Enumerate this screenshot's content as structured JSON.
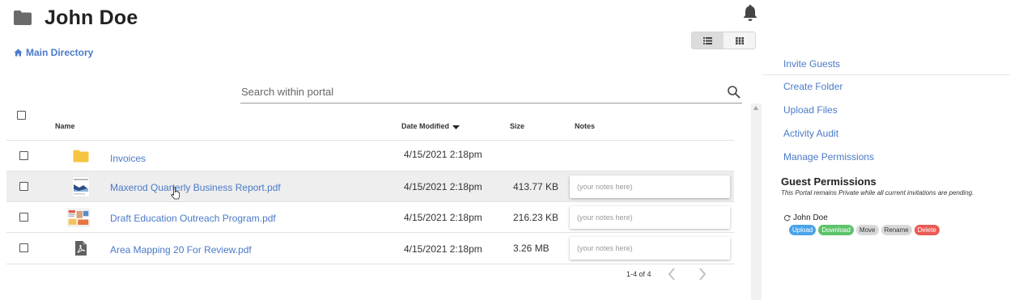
{
  "header": {
    "title": "John Doe",
    "icon": "folder-icon"
  },
  "breadcrumb": {
    "label": "Main Directory",
    "icon": "home-icon"
  },
  "view_toggle": {
    "options": [
      "list-view-icon",
      "grid-view-icon"
    ],
    "selected": "list-view-icon"
  },
  "search": {
    "placeholder": "Search within portal",
    "value": ""
  },
  "table": {
    "columns": {
      "name": "Name",
      "date": "Date Modified",
      "size": "Size",
      "notes": "Notes"
    },
    "sort": {
      "column": "Date Modified",
      "direction": "descending"
    },
    "rows": [
      {
        "name": "Invoices",
        "type": "folder",
        "date": "4/15/2021 2:18pm",
        "size": "",
        "notes": ""
      },
      {
        "name": "Maxerod Quarterly Business Report.pdf",
        "type": "pdf-thumbnail",
        "date": "4/15/2021 2:18pm",
        "size": "413.77 KB",
        "notes": ""
      },
      {
        "name": "Draft Education Outreach Program.pdf",
        "type": "pdf-thumbnail",
        "date": "4/15/2021 2:18pm",
        "size": "216.23 KB",
        "notes": ""
      },
      {
        "name": "Area Mapping 20 For Review.pdf",
        "type": "pdf",
        "date": "4/15/2021 2:18pm",
        "size": "3.26 MB",
        "notes": ""
      }
    ],
    "notes_placeholder": "(your notes here)"
  },
  "pagination": {
    "label": "1-4 of 4"
  },
  "sidebar": {
    "actions": [
      "Invite Guests",
      "Create Folder",
      "Upload Files",
      "Activity Audit",
      "Manage Permissions"
    ],
    "guest_permissions": {
      "title": "Guest Permissions",
      "note": "This Portal remains Private while all current invitations are pending.",
      "guest": "John Doe",
      "badges": [
        {
          "label": "Upload",
          "bg": "#4aa3e8",
          "fg": "#ffffff"
        },
        {
          "label": "Download",
          "bg": "#5cc46a",
          "fg": "#ffffff"
        },
        {
          "label": "Move",
          "bg": "#d8d8d8",
          "fg": "#333333"
        },
        {
          "label": "Rename",
          "bg": "#d8d8d8",
          "fg": "#333333"
        },
        {
          "label": "Delete",
          "bg": "#ea5a55",
          "fg": "#ffffff"
        }
      ]
    }
  },
  "colors": {
    "link": "#4a7ac8",
    "folder": "#f5c542",
    "hover_row": "#eeeeee"
  }
}
